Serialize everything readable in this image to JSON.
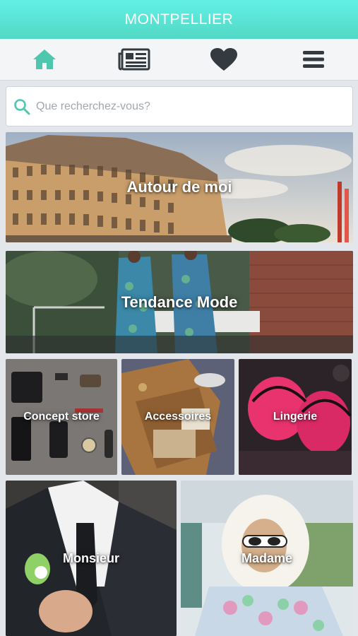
{
  "header": {
    "title": "MONTPELLIER"
  },
  "nav": {
    "items": [
      {
        "icon": "home-icon",
        "color": "#4fc7ae"
      },
      {
        "icon": "newspaper-icon",
        "color": "#333a40"
      },
      {
        "icon": "heart-icon",
        "color": "#333a40"
      },
      {
        "icon": "menu-icon",
        "color": "#333a40"
      }
    ]
  },
  "search": {
    "placeholder": "Que recherchez-vous?",
    "value": ""
  },
  "tiles": {
    "autour": "Autour de moi",
    "tendance": "Tendance Mode",
    "concept": "Concept store",
    "accessoires": "Accessoires",
    "lingerie": "Lingerie",
    "monsieur": "Monsieur",
    "madame": "Madame"
  },
  "colors": {
    "accent": "#4fc7ae",
    "header": "#5ae4d2"
  }
}
